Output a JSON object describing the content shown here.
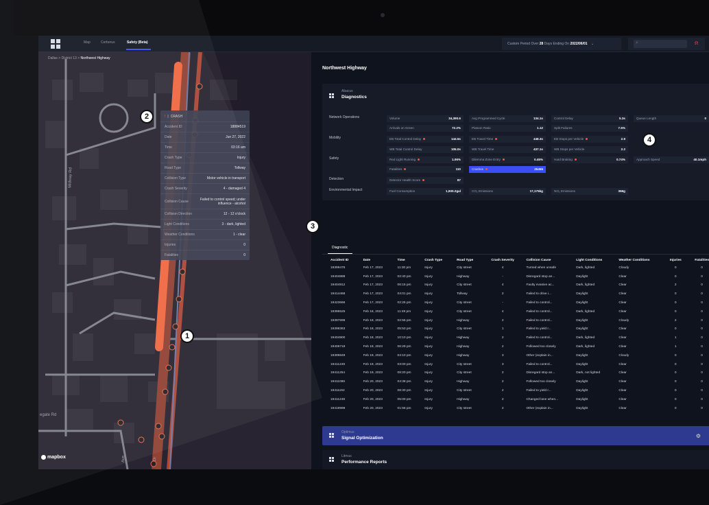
{
  "nav": {
    "items": [
      {
        "label": "Map"
      },
      {
        "label": "Cerberus"
      },
      {
        "label": "Safety (Beta)"
      }
    ],
    "period": {
      "prefix": "Custom Period",
      "over": "Over",
      "days": "28",
      "days_label": "Days",
      "ending": "Ending",
      "on": "On",
      "date": "2022/06/01",
      "chevron": "⌄"
    },
    "search_icon": "⌕",
    "bell_icon": "⍾"
  },
  "breadcrumb": {
    "parts": [
      "Dallas",
      "District 13",
      "Northwest Highway"
    ],
    "sep": ">"
  },
  "map": {
    "street_labels": [
      "Midway Rd",
      "egate Rd",
      "Ave",
      "Dr"
    ],
    "mapbox": "mapbox",
    "popup": {
      "icon": "!",
      "title": "CRASH",
      "rows": [
        {
          "k": "Accident ID",
          "v": "18884519"
        },
        {
          "k": "Date",
          "v": "Jun 27, 2022"
        },
        {
          "k": "Time",
          "v": "03:16 am"
        },
        {
          "k": "Crash Type",
          "v": "Injury"
        },
        {
          "k": "Road Type",
          "v": "Tollway"
        },
        {
          "k": "Collision Type",
          "v": "Motor vehicle in transport"
        },
        {
          "k": "Crash Severity",
          "v": "4 - damaged 4"
        },
        {
          "k": "Collision Cause",
          "v": "Failed to control speed; under influence - alcohol"
        },
        {
          "k": "Collision Direction",
          "v": "12 - 12 o'clock"
        },
        {
          "k": "Light Conditions",
          "v": "3 - dark, lighted"
        },
        {
          "k": "Weather Conditions",
          "v": "1 - clear"
        },
        {
          "k": "Injuries",
          "v": "0"
        },
        {
          "k": "Fatalities",
          "v": "0"
        }
      ]
    }
  },
  "panel": {
    "title": "Northwest Highway",
    "abacus": {
      "sub": "Abacus",
      "title": "Diagnostics"
    },
    "sections": [
      "Network Operations",
      "Mobility",
      "Safety",
      "Detection",
      "Environmental Impact"
    ],
    "metrics": [
      {
        "label": "Volume",
        "value": "34,390.6",
        "dot": false
      },
      {
        "label": "Avg Programmed Cycle",
        "value": "134.1s",
        "dot": false
      },
      {
        "label": "Control Delay",
        "value": "5.3s",
        "dot": false
      },
      {
        "label": "Queue Length",
        "value": "0",
        "dot": false
      },
      {
        "label": "Arrivals on Green",
        "value": "72.2%",
        "dot": false
      },
      {
        "label": "Platoon Ratio",
        "value": "1.12",
        "dot": false
      },
      {
        "label": "Split Failures",
        "value": "7.5%",
        "dot": false
      },
      {
        "label": "EB Total Control Delay",
        "value": "144.5s",
        "dot": true
      },
      {
        "label": "EB Travel Time",
        "value": "448.3s",
        "dot": true
      },
      {
        "label": "EB Stops per Vehicle",
        "value": "2.9",
        "dot": true
      },
      {
        "label": "WB Total Control Delay",
        "value": "105.0s",
        "dot": false
      },
      {
        "label": "WB Travel Time",
        "value": "437.1s",
        "dot": false
      },
      {
        "label": "WB Stops per Vehicle",
        "value": "2.2",
        "dot": false
      },
      {
        "label": "Red Light Running",
        "value": "1.06%",
        "dot": true
      },
      {
        "label": "Dilemma Zone Entry",
        "value": "0.45%",
        "dot": true
      },
      {
        "label": "Hard Braking",
        "value": "0.74%",
        "dot": true
      },
      {
        "label": "Approach Speed",
        "value": "40.1mph",
        "dot": false
      },
      {
        "label": "Fatalities",
        "value": "110",
        "dot": true
      },
      {
        "label": "Crashes",
        "value": "25455",
        "dot": true
      },
      {
        "label": "Detector Health Score",
        "value": "87",
        "dot": true
      },
      {
        "label": "Fuel Consumption",
        "value": "1,930.2gal",
        "dot": false
      },
      {
        "label": "CO₂ Emissions",
        "value": "17,175kg",
        "dot": false
      },
      {
        "label": "NO₂ Emissions",
        "value": "366g",
        "dot": false
      }
    ],
    "tab": "Diagnostic",
    "table": {
      "headers": [
        "Accident ID",
        "Date",
        "Time",
        "Crash Type",
        "Road Type",
        "Crash Severity",
        "Collision Cause",
        "Light Conditions",
        "Weather Conditions",
        "Injuries",
        "Fatalities"
      ],
      "rows": [
        [
          "19399476",
          "Feb 17, 2023",
          "11:30 pm",
          "Injury",
          "City street",
          "4",
          "Turned when unsafe",
          "Dark, lighted",
          "Cloudy",
          "0",
          "0"
        ],
        [
          "19404888",
          "Feb 17, 2023",
          "02:40 pm",
          "Injury",
          "Highway",
          "-",
          "Disregard stop an...",
          "Daylight",
          "Clear",
          "0",
          "0"
        ],
        [
          "19404912",
          "Feb 17, 2023",
          "06:15 pm",
          "Injury",
          "City street",
          "4",
          "Faulty evasive ac...",
          "Dark, lighted",
          "Clear",
          "2",
          "0"
        ],
        [
          "19414468",
          "Feb 17, 2023",
          "04:01 pm",
          "Injury",
          "Tollway",
          "2",
          "Failed to drive i...",
          "Daylight",
          "Clear",
          "0",
          "0"
        ],
        [
          "19423666",
          "Feb 17, 2023",
          "02:25 pm",
          "Injury",
          "City street",
          "-",
          "Failed to control...",
          "Daylight",
          "Clear",
          "0",
          "0"
        ],
        [
          "19395525",
          "Feb 18, 2023",
          "11:49 pm",
          "Injury",
          "City street",
          "4",
          "Failed to control...",
          "Dark, lighted",
          "Clear",
          "0",
          "0"
        ],
        [
          "19397698",
          "Feb 18, 2023",
          "02:55 pm",
          "Injury",
          "Highway",
          "2",
          "Failed to control...",
          "Daylight",
          "Cloudy",
          "2",
          "0"
        ],
        [
          "19398363",
          "Feb 18, 2023",
          "05:53 pm",
          "Injury",
          "City street",
          "1",
          "Failed to yield r...",
          "Daylight",
          "Clear",
          "0",
          "0"
        ],
        [
          "19404900",
          "Feb 18, 2023",
          "10:10 pm",
          "Injury",
          "Highway",
          "2",
          "Failed to control...",
          "Dark, lighted",
          "Clear",
          "1",
          "0"
        ],
        [
          "19406718",
          "Feb 18, 2023",
          "06:29 pm",
          "Injury",
          "Highway",
          "2",
          "Followed too closely",
          "Dark, lighted",
          "Clear",
          "1",
          "0"
        ],
        [
          "19399849",
          "Feb 19, 2023",
          "04:10 pm",
          "Injury",
          "Highway",
          "3",
          "Other (explain in...",
          "Daylight",
          "Cloudy",
          "0",
          "0"
        ],
        [
          "19411249",
          "Feb 19, 2023",
          "03:00 pm",
          "Injury",
          "City street",
          "3",
          "Failed to control...",
          "Daylight",
          "Clear",
          "0",
          "0"
        ],
        [
          "19411254",
          "Feb 19, 2023",
          "08:20 pm",
          "Injury",
          "City street",
          "2",
          "Disregard stop an...",
          "Dark, not lighted",
          "Clear",
          "0",
          "0"
        ],
        [
          "19411086",
          "Feb 20, 2023",
          "04:38 pm",
          "Injury",
          "Highway",
          "2",
          "Followed too closely",
          "Daylight",
          "Clear",
          "0",
          "0"
        ],
        [
          "19411192",
          "Feb 20, 2023",
          "08:30 pm",
          "Injury",
          "City street",
          "2",
          "Failed to yield r...",
          "Daylight",
          "Clear",
          "0",
          "0"
        ],
        [
          "19411248",
          "Feb 20, 2023",
          "05:00 pm",
          "Injury",
          "Highway",
          "2",
          "Changed lane when...",
          "Daylight",
          "Clear",
          "0",
          "0"
        ],
        [
          "19419999",
          "Feb 20, 2023",
          "01:56 pm",
          "Injury",
          "City street",
          "2",
          "Other (explain in...",
          "Daylight",
          "Clear",
          "0",
          "0"
        ]
      ]
    },
    "optimus": {
      "sub": "Optimus",
      "title": "Signal Optimization",
      "gear": "⚙"
    },
    "litmus": {
      "sub": "Litmus",
      "title": "Performance Reports"
    }
  },
  "callouts": [
    "1",
    "2",
    "3",
    "4"
  ],
  "colors": {
    "accent": "#3b4ef5",
    "danger": "#e85a42",
    "road": "#e0552f"
  }
}
